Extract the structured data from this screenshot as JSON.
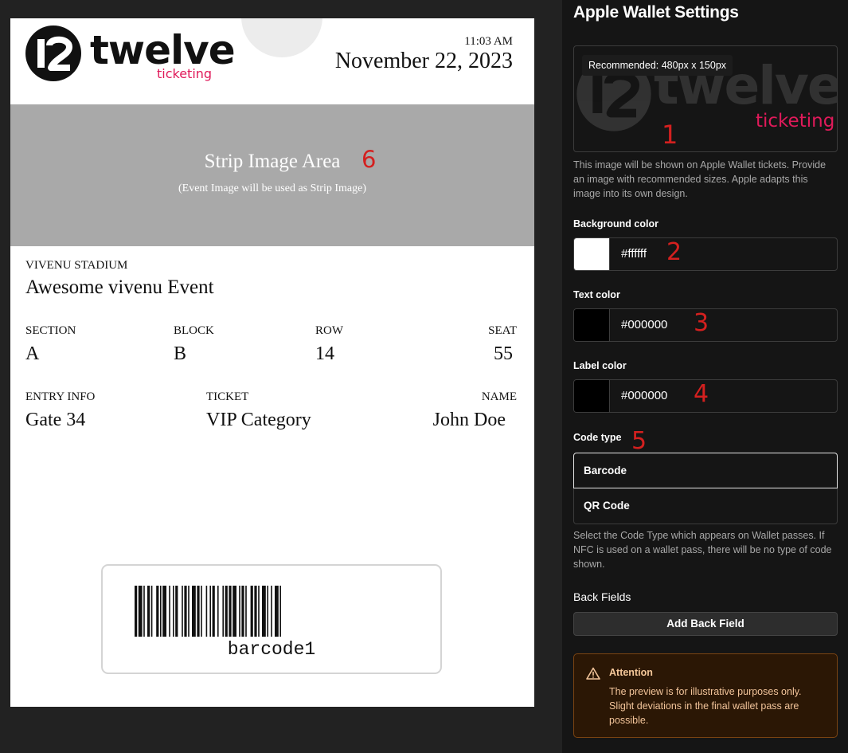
{
  "pass": {
    "brand": {
      "word": "twelve",
      "sub": "ticketing"
    },
    "time": "11:03 AM",
    "date": "November 22, 2023",
    "strip": {
      "title": "Strip Image Area",
      "subtitle": "(Event Image will be used as Strip Image)",
      "marker": "6"
    },
    "venue": "VIVENU STADIUM",
    "event": "Awesome vivenu Event",
    "row1": [
      {
        "label": "SECTION",
        "value": "A"
      },
      {
        "label": "BLOCK",
        "value": "B"
      },
      {
        "label": "ROW",
        "value": "14"
      },
      {
        "label": "SEAT",
        "value": "55"
      }
    ],
    "row2": [
      {
        "label": "ENTRY INFO",
        "value": "Gate 34"
      },
      {
        "label": "TICKET",
        "value": "VIP Category"
      },
      {
        "label": "NAME",
        "value": "John Doe"
      }
    ],
    "barcode": {
      "text": "barcode1"
    }
  },
  "settings": {
    "title": "Apple Wallet Settings",
    "logo_upload": {
      "badge": "Recommended: 480px x 150px",
      "marker": "1",
      "help": "This image will be shown on Apple Wallet tickets. Provide an image with recommended sizes. Apple adapts this image into its own design."
    },
    "background_color": {
      "label": "Background color",
      "value": "#ffffff",
      "swatch": "#ffffff",
      "marker": "2"
    },
    "text_color": {
      "label": "Text color",
      "value": "#000000",
      "swatch": "#000000",
      "marker": "3"
    },
    "label_color": {
      "label": "Label color",
      "value": "#000000",
      "swatch": "#000000",
      "marker": "4"
    },
    "code_type": {
      "label": "Code type",
      "marker": "5",
      "options": [
        "Barcode",
        "QR Code"
      ],
      "selected": "Barcode",
      "help": "Select the Code Type which appears on Wallet passes. If NFC is used on a wallet pass, there will be no type of code shown."
    },
    "back_fields": {
      "title": "Back Fields",
      "add_button": "Add Back Field"
    },
    "attention": {
      "icon": "warning-triangle-icon",
      "title": "Attention",
      "text": "The preview is for illustrative purposes only. Slight deviations in the final wallet pass are possible."
    }
  },
  "colors": {
    "marker": "#d4201f",
    "brand_pink": "#e01a5a",
    "strip_gray": "#a9a9a9",
    "panel_bg": "#151515",
    "attention_text": "#f2c49a"
  }
}
